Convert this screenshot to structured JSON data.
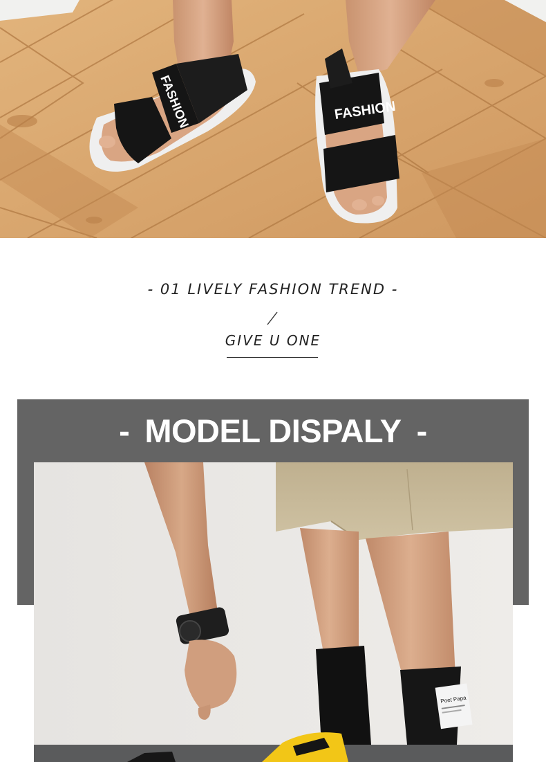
{
  "top_photo": {
    "strap_text_left": "FASHION",
    "strap_text_right": "FASHION"
  },
  "tagline": {
    "line1": "- 01 LIVELY FASHION TREND -",
    "line2": "GIVE U ONE"
  },
  "banner": {
    "dash_left": "-",
    "title": "MODEL DISPALY",
    "dash_right": "-"
  },
  "model_photo": {
    "sock_label": "Poet Papa"
  },
  "colors": {
    "banner_gray": "#646464",
    "wood": "#d9a66e",
    "sandal_black": "#151515",
    "sole_white": "#efefef",
    "wall": "#e9e7e4",
    "shorts_khaki": "#c9bb9a",
    "slide_yellow": "#f2c617"
  }
}
